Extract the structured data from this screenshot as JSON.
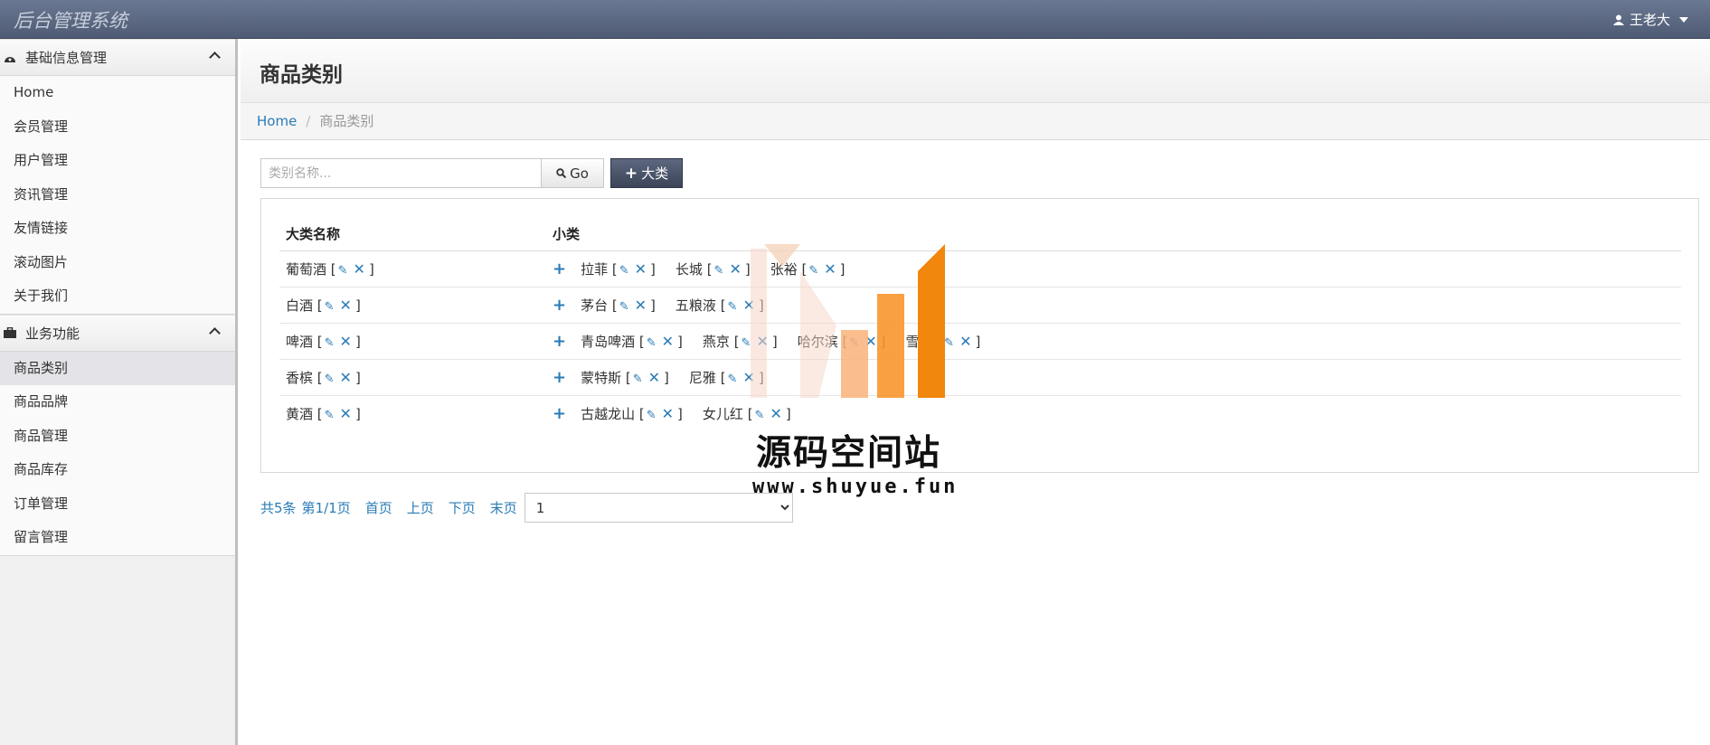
{
  "app": {
    "title": "后台管理系统",
    "user_name": "王老大"
  },
  "sidebar": {
    "sections": [
      {
        "title": "基础信息管理",
        "items": [
          "Home",
          "会员管理",
          "用户管理",
          "资讯管理",
          "友情链接",
          "滚动图片",
          "关于我们"
        ]
      },
      {
        "title": "业务功能",
        "items": [
          "商品类别",
          "商品品牌",
          "商品管理",
          "商品库存",
          "订单管理",
          "留言管理"
        ]
      }
    ],
    "active_item": "商品类别"
  },
  "main": {
    "page_title": "商品类别",
    "breadcrumb": {
      "home": "Home",
      "current": "商品类别"
    },
    "search": {
      "placeholder": "类别名称...",
      "go_label": "Go",
      "add_label": "大类"
    },
    "table": {
      "headers": [
        "大类名称",
        "小类"
      ],
      "rows": [
        {
          "name": "葡萄酒",
          "subs": [
            "拉菲",
            "长城",
            "张裕"
          ]
        },
        {
          "name": "白酒",
          "subs": [
            "茅台",
            "五粮液"
          ]
        },
        {
          "name": "啤酒",
          "subs": [
            "青岛啤酒",
            "燕京",
            "哈尔滨",
            "雪花"
          ]
        },
        {
          "name": "香槟",
          "subs": [
            "蒙特斯",
            "尼雅"
          ]
        },
        {
          "name": "黄酒",
          "subs": [
            "古越龙山",
            "女儿红"
          ]
        }
      ]
    },
    "pager": {
      "total": "共5条",
      "page_info": "第1/1页",
      "first": "首页",
      "prev": "上页",
      "next": "下页",
      "last": "末页",
      "selected_page": "1"
    }
  },
  "watermark": {
    "text": "源码空间站",
    "url": "www.shuyue.fun"
  }
}
